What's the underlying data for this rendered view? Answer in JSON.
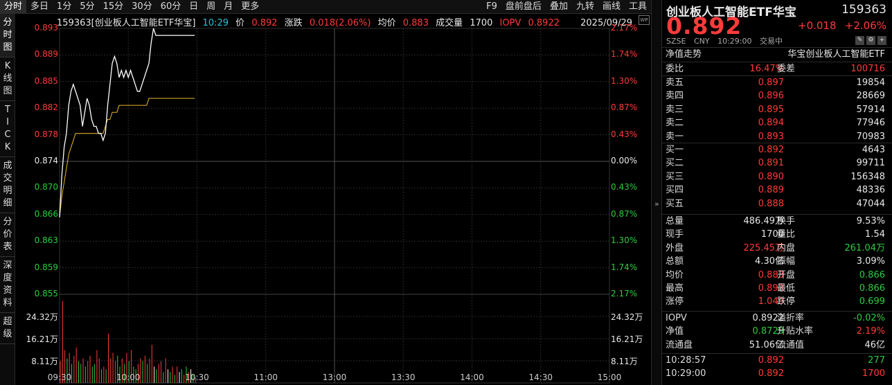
{
  "tabs": [
    "分时",
    "多日",
    "1分",
    "5分",
    "15分",
    "30分",
    "60分",
    "日",
    "周",
    "月",
    "更多"
  ],
  "tools": [
    "F9",
    "盘前盘后",
    "叠加",
    "九转",
    "画线",
    "工具"
  ],
  "sidenav": [
    "分时图",
    "K线图",
    "TICK",
    "成交明细",
    "分价表",
    "深度资料",
    "超级"
  ],
  "header_info": {
    "code_name": "159363[创业板人工智能ETF华宝]",
    "time": "10:29",
    "price_label": "价",
    "price": "0.892",
    "chg_label": "涨跌",
    "chg": "0.018(2.06%)",
    "avg_label": "均价",
    "avg": "0.883",
    "vol_label": "成交量",
    "vol": "1700",
    "iopv_label": "IOPV",
    "iopv": "0.8922",
    "date": "2025/09/29"
  },
  "wp_badge": "WP",
  "price_axis_left": [
    "0.893",
    "0.889",
    "0.885",
    "0.882",
    "0.878",
    "0.874",
    "0.870",
    "0.866",
    "0.863",
    "0.859",
    "0.855"
  ],
  "price_axis_right": [
    "2.17%",
    "1.74%",
    "1.30%",
    "0.87%",
    "0.43%",
    "0.00%",
    "0.43%",
    "0.87%",
    "1.30%",
    "1.74%",
    "2.17%"
  ],
  "vol_axis_left": [
    "24.32万",
    "16.21万",
    "8.11万"
  ],
  "vol_axis_right": [
    "24.32万",
    "16.21万",
    "8.11万"
  ],
  "time_labels": [
    "09:30",
    "10:00",
    "10:30",
    "11:00",
    "13:00",
    "13:30",
    "14:00",
    "14:30",
    "15:00"
  ],
  "chart_data": {
    "type": "line",
    "prev_close": 0.874,
    "ylim": [
      0.855,
      0.893
    ],
    "x": [
      "09:30",
      "09:31",
      "09:32",
      "09:33",
      "09:34",
      "09:35",
      "09:36",
      "09:37",
      "09:38",
      "09:39",
      "09:40",
      "09:41",
      "09:42",
      "09:43",
      "09:44",
      "09:45",
      "09:46",
      "09:47",
      "09:48",
      "09:49",
      "09:50",
      "09:51",
      "09:52",
      "09:53",
      "09:54",
      "09:55",
      "09:56",
      "09:57",
      "09:58",
      "09:59",
      "10:00",
      "10:01",
      "10:02",
      "10:03",
      "10:04",
      "10:05",
      "10:06",
      "10:07",
      "10:08",
      "10:09",
      "10:10",
      "10:11",
      "10:12",
      "10:13",
      "10:14",
      "10:15",
      "10:16",
      "10:17",
      "10:18",
      "10:19",
      "10:20",
      "10:21",
      "10:22",
      "10:23",
      "10:24",
      "10:25",
      "10:26",
      "10:27",
      "10:28",
      "10:29"
    ],
    "series": [
      {
        "values": [
          0.866,
          0.872,
          0.876,
          0.878,
          0.882,
          0.884,
          0.885,
          0.884,
          0.883,
          0.882,
          0.879,
          0.881,
          0.883,
          0.882,
          0.88,
          0.879,
          0.879,
          0.878,
          0.878,
          0.877,
          0.878,
          0.882,
          0.885,
          0.888,
          0.889,
          0.888,
          0.886,
          0.887,
          0.886,
          0.887,
          0.886,
          0.887,
          0.886,
          0.885,
          0.884,
          0.884,
          0.885,
          0.886,
          0.887,
          0.888,
          0.891,
          0.893,
          0.892,
          0.892,
          0.892,
          0.892,
          0.892,
          0.892,
          0.892,
          0.892,
          0.892,
          0.892,
          0.892,
          0.892,
          0.892,
          0.892,
          0.892,
          0.892,
          0.892,
          0.892
        ]
      },
      {
        "values": [
          0.866,
          0.869,
          0.871,
          0.873,
          0.875,
          0.876,
          0.877,
          0.878,
          0.878,
          0.878,
          0.878,
          0.878,
          0.878,
          0.878,
          0.878,
          0.878,
          0.878,
          0.878,
          0.878,
          0.878,
          0.879,
          0.88,
          0.88,
          0.881,
          0.881,
          0.881,
          0.882,
          0.882,
          0.882,
          0.882,
          0.882,
          0.882,
          0.882,
          0.882,
          0.882,
          0.882,
          0.882,
          0.882,
          0.882,
          0.883,
          0.883,
          0.883,
          0.883,
          0.883,
          0.883,
          0.883,
          0.883,
          0.883,
          0.883,
          0.883,
          0.883,
          0.883,
          0.883,
          0.883,
          0.883,
          0.883,
          0.883,
          0.883,
          0.883,
          0.883
        ]
      }
    ],
    "volume": [
      8,
      30,
      12,
      9,
      11,
      7,
      10,
      13,
      8,
      7,
      9,
      6,
      8,
      10,
      6,
      7,
      12,
      9,
      5,
      6,
      5,
      18,
      9,
      11,
      8,
      10,
      6,
      9,
      7,
      11,
      8,
      12,
      6,
      5,
      7,
      9,
      8,
      10,
      7,
      9,
      14,
      6,
      5,
      7,
      8,
      4,
      9,
      5,
      4,
      6,
      3,
      6,
      4,
      5,
      3,
      6,
      4,
      5,
      3,
      2
    ],
    "volume_colors": [
      "r",
      "r",
      "r",
      "g",
      "r",
      "g",
      "r",
      "r",
      "g",
      "g",
      "r",
      "g",
      "r",
      "r",
      "g",
      "g",
      "r",
      "r",
      "g",
      "r",
      "g",
      "r",
      "r",
      "r",
      "r",
      "g",
      "g",
      "r",
      "g",
      "r",
      "g",
      "r",
      "g",
      "g",
      "r",
      "r",
      "g",
      "r",
      "g",
      "r",
      "r",
      "w",
      "g",
      "r",
      "r",
      "g",
      "r",
      "w",
      "g",
      "r",
      "g",
      "r",
      "w",
      "g",
      "r",
      "g",
      "r",
      "w",
      "g",
      "r"
    ]
  },
  "side": {
    "name": "创业板人工智能ETF华宝",
    "code": "159363",
    "price": "0.892",
    "chg": "+0.018",
    "pct": "+2.06%",
    "meta": [
      "SZSE",
      "CNY",
      "10:29:00",
      "交易中"
    ],
    "icons": [
      "✎",
      "⚙",
      "+"
    ],
    "nav_label": "净值走势",
    "nav_name": "华宝创业板人工智能ETF",
    "webi": {
      "l1": "委比",
      "v1": "16.47%",
      "l2": "委差",
      "v2": "100716"
    },
    "asks": [
      {
        "l": "卖五",
        "p": "0.897",
        "v": "19854"
      },
      {
        "l": "卖四",
        "p": "0.896",
        "v": "28669"
      },
      {
        "l": "卖三",
        "p": "0.895",
        "v": "57914"
      },
      {
        "l": "卖二",
        "p": "0.894",
        "v": "77946"
      },
      {
        "l": "卖一",
        "p": "0.893",
        "v": "70983"
      }
    ],
    "bids": [
      {
        "l": "买一",
        "p": "0.892",
        "v": "4643"
      },
      {
        "l": "买二",
        "p": "0.891",
        "v": "99711"
      },
      {
        "l": "买三",
        "p": "0.890",
        "v": "156348"
      },
      {
        "l": "买四",
        "p": "0.889",
        "v": "48336"
      },
      {
        "l": "买五",
        "p": "0.888",
        "v": "47044"
      }
    ],
    "stats": [
      {
        "l1": "总量",
        "v1": "486.49万",
        "c1": "wh",
        "l2": "换手",
        "v2": "9.53%",
        "c2": "wh"
      },
      {
        "l1": "现手",
        "v1": "1700",
        "c1": "wh",
        "l2": "量比",
        "v2": "1.54",
        "c2": "wh"
      },
      {
        "l1": "外盘",
        "v1": "225.45万",
        "c1": "red",
        "l2": "内盘",
        "v2": "261.04万",
        "c2": "grn"
      },
      {
        "l1": "总额",
        "v1": "4.30亿",
        "c1": "wh",
        "l2": "振幅",
        "v2": "3.09%",
        "c2": "wh"
      },
      {
        "l1": "均价",
        "v1": "0.883",
        "c1": "red",
        "l2": "开盘",
        "v2": "0.866",
        "c2": "grn"
      },
      {
        "l1": "最高",
        "v1": "0.893",
        "c1": "red",
        "l2": "最低",
        "v2": "0.866",
        "c2": "grn"
      },
      {
        "l1": "涨停",
        "v1": "1.049",
        "c1": "red",
        "l2": "跌停",
        "v2": "0.699",
        "c2": "grn"
      }
    ],
    "stats2": [
      {
        "l1": "IOPV",
        "v1": "0.8922",
        "c1": "wh",
        "l2": "溢折率",
        "v2": "-0.02%",
        "c2": "grn"
      },
      {
        "l1": "净值",
        "v1": "0.8729",
        "c1": "grn",
        "l2": "升贴水率",
        "v2": "2.19%",
        "c2": "red"
      },
      {
        "l1": "流通盘",
        "v1": "51.06亿",
        "c1": "wh",
        "l2": "流通值",
        "v2": "46亿",
        "c2": "wh"
      }
    ],
    "ticks": [
      {
        "t": "10:28:57",
        "p": "0.892",
        "v": "277",
        "c": "grn"
      },
      {
        "t": "10:29:00",
        "p": "0.892",
        "v": "1700",
        "c": "red"
      }
    ]
  }
}
